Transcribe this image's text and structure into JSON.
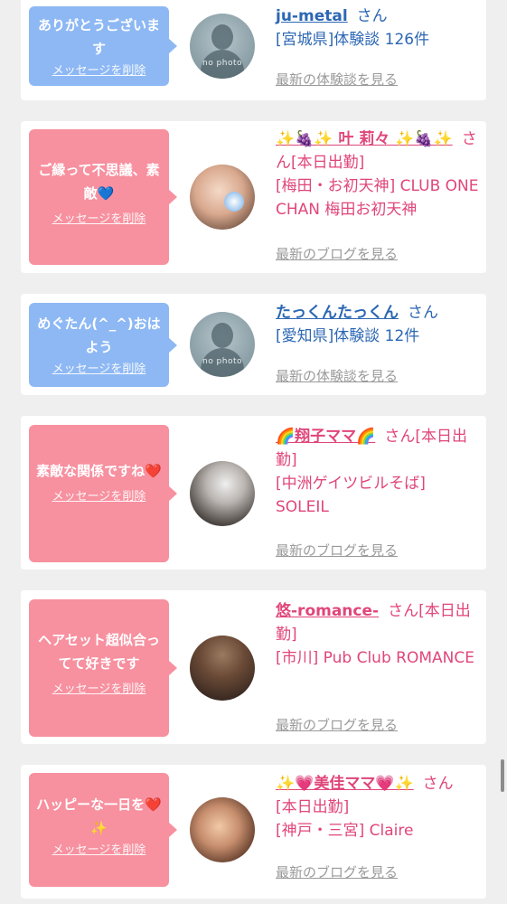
{
  "items": [
    {
      "type": "blue",
      "message": "ありがとうございます",
      "delete_label": "メッセージを削除",
      "name": "ju-metal",
      "san": "さん",
      "details": [
        "[宮城県]体験談 126件"
      ],
      "more": "最新の体験談を見る",
      "avatar": "no-photo"
    },
    {
      "type": "pink",
      "message": "ご縁って不思議、素敵💙",
      "delete_label": "メッセージを削除",
      "name": "✨🍇✨ 叶 莉々 ✨🍇✨",
      "san": "さん[本日出勤]",
      "details": [
        "[梅田・お初天神] CLUB ONE CHAN 梅田お初天神"
      ],
      "more": "最新のブログを見る",
      "avatar": "photo"
    },
    {
      "type": "blue",
      "message": "めぐたん(^_^)おはよう",
      "delete_label": "メッセージを削除",
      "name": "たっくんたっくん",
      "san": "さん",
      "details": [
        "[愛知県]体験談 12件"
      ],
      "more": "最新の体験談を見る",
      "avatar": "no-photo"
    },
    {
      "type": "pink",
      "message": "素敵な関係ですね❤️",
      "delete_label": "メッセージを削除",
      "name": "🌈翔子ママ🌈",
      "san": "さん[本日出勤]",
      "details": [
        "[中洲ゲイツビルそば] SOLEIL"
      ],
      "more": "最新のブログを見る",
      "avatar": "photo"
    },
    {
      "type": "pink",
      "message": "ヘアセット超似合ってて好きです",
      "delete_label": "メッセージを削除",
      "name": "悠-romance-",
      "san": "さん[本日出勤]",
      "details": [
        "[市川] Pub Club ROMANCE"
      ],
      "more": "最新のブログを見る",
      "avatar": "photo"
    },
    {
      "type": "pink",
      "message": "ハッピーな一日を❤️✨",
      "delete_label": "メッセージを削除",
      "name": "✨💗美佳ママ💗✨",
      "san": "さん",
      "details": [
        "[本日出勤]",
        "[神戸・三宮] Claire"
      ],
      "more": "最新のブログを見る",
      "avatar": "photo"
    }
  ],
  "no_photo_text": "no photo"
}
